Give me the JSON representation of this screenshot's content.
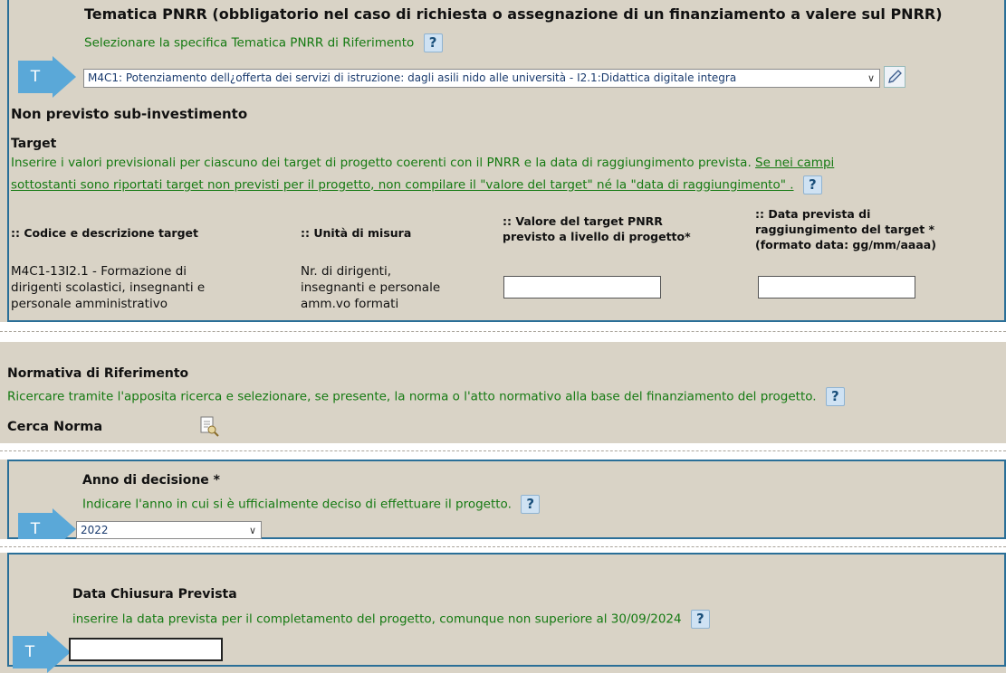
{
  "tematica": {
    "title": "Tematica PNRR (obbligatorio nel caso di richiesta o assegnazione di un finanziamento a valere sul PNRR)",
    "hint": "Selezionare la specifica Tematica PNRR di Riferimento",
    "selected": "M4C1: Potenziamento dell¿offerta dei servizi di istruzione: dagli asili nido alle università - I2.1:Didattica digitale integra",
    "t_label": "T"
  },
  "sub": {
    "label": "Non previsto sub-investimento"
  },
  "target": {
    "title": "Target",
    "hint_part1": "Inserire i valori previsionali per ciascuno dei target di progetto coerenti con il PNRR e la data di raggiungimento prevista.",
    "hint_link_line1": "Se nei campi",
    "hint_link_line2": "sottostanti sono riportati target non previsti per il progetto, non compilare il \"valore del target\" né la \"data di raggiungimento\" .",
    "headers": {
      "codice": ":: Codice e descrizione target",
      "unita": ":: Unità di misura",
      "valore_1": ":: Valore del target PNRR",
      "valore_2": "previsto a livello di progetto*",
      "data_1": ":: Data prevista di",
      "data_2": "raggiungimento del target *",
      "data_3": "(formato data: gg/mm/aaaa)"
    },
    "row": {
      "codice_1": "M4C1-13I2.1 - Formazione di",
      "codice_2": "dirigenti scolastici, insegnanti e",
      "codice_3": "personale amministrativo",
      "unita_1": "Nr. di dirigenti,",
      "unita_2": "insegnanti e personale",
      "unita_3": "amm.vo formati",
      "valore": "",
      "data": ""
    }
  },
  "normativa": {
    "title": "Normativa di Riferimento",
    "hint": "Ricercare tramite l'apposita ricerca e selezionare, se presente, la norma o l'atto normativo alla base del finanziamento del progetto.",
    "cerca": "Cerca Norma"
  },
  "anno": {
    "title": "Anno di decisione *",
    "hint": "Indicare l'anno in cui si è ufficialmente deciso di effettuare il progetto.",
    "selected": "2022",
    "t_label": "T"
  },
  "chiusura": {
    "title": "Data Chiusura Prevista",
    "hint": "inserire la data prevista per il completamento del progetto, comunque non superiore al 30/09/2024",
    "value": "",
    "t_label": "T"
  },
  "help_symbol": "?",
  "colors": {
    "background": "#d9d3c6",
    "hint_green": "#157a12",
    "border_blue": "#2a6f98",
    "arrow_blue": "#5aa8d8"
  }
}
